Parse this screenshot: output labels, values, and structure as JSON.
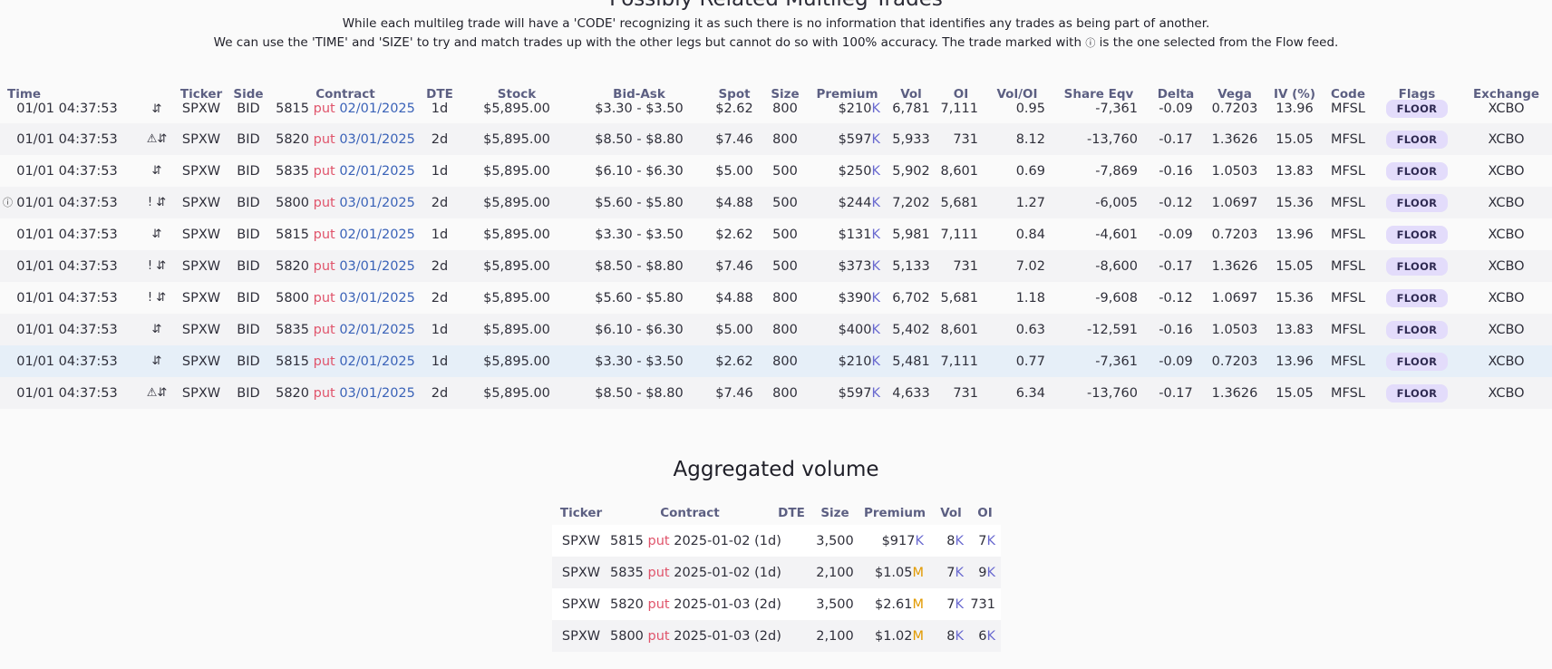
{
  "page": {
    "title": "Possibly Related Multileg Trades",
    "desc1": "While each multileg trade will have a 'CODE' recognizing it as such there is no information that identifies any trades as being part of another.",
    "desc2a": "We can use the 'TIME' and 'SIZE' to try and match trades up with the other legs but cannot do so with 100% accuracy. The trade marked with",
    "desc2b": "is the one selected from the Flow feed.",
    "info_icon": "ⓘ"
  },
  "columns": [
    "Time",
    "Ticker",
    "Side",
    "Contract",
    "DTE",
    "Stock",
    "Bid-Ask",
    "Spot",
    "Size",
    "Premium",
    "Vol",
    "OI",
    "Vol/OI",
    "Share Eqv",
    "Delta",
    "Vega",
    "IV (%)",
    "Code",
    "Flags",
    "Exchange"
  ],
  "rows": [
    {
      "time": "01/01 04:37:53",
      "icons": "⇵",
      "ticker": "SPXW",
      "side": "BID",
      "strike": "5815",
      "type": "put",
      "exp": "02/01/2025",
      "dte": "1d",
      "stock": "$5,895.00",
      "bidask": "$3.30 - $3.50",
      "spot": "$2.62",
      "size": "800",
      "size_hi": false,
      "prem": "$210",
      "prem_unit": "K",
      "vol": "6,781",
      "oi": "7,111",
      "voloi": "0.95",
      "share": "-7,361",
      "delta": "-0.09",
      "vega": "0.7203",
      "iv": "13.96",
      "code": "MFSL",
      "flag": "FLOOR",
      "exch": "XCBO",
      "selected": false,
      "info": false
    },
    {
      "time": "01/01 04:37:53",
      "icons": "⚠⇵",
      "ticker": "SPXW",
      "side": "BID",
      "strike": "5820",
      "type": "put",
      "exp": "03/01/2025",
      "dte": "2d",
      "stock": "$5,895.00",
      "bidask": "$8.50 - $8.80",
      "spot": "$7.46",
      "size": "800",
      "size_hi": true,
      "prem": "$597",
      "prem_unit": "K",
      "vol": "5,933",
      "oi": "731",
      "voloi": "8.12",
      "share": "-13,760",
      "delta": "-0.17",
      "vega": "1.3626",
      "iv": "15.05",
      "code": "MFSL",
      "flag": "FLOOR",
      "exch": "XCBO",
      "selected": false,
      "info": false
    },
    {
      "time": "01/01 04:37:53",
      "icons": "⇵",
      "ticker": "SPXW",
      "side": "BID",
      "strike": "5835",
      "type": "put",
      "exp": "02/01/2025",
      "dte": "1d",
      "stock": "$5,895.00",
      "bidask": "$6.10 - $6.30",
      "spot": "$5.00",
      "size": "500",
      "size_hi": false,
      "prem": "$250",
      "prem_unit": "K",
      "vol": "5,902",
      "oi": "8,601",
      "voloi": "0.69",
      "share": "-7,869",
      "delta": "-0.16",
      "vega": "1.0503",
      "iv": "13.83",
      "code": "MFSL",
      "flag": "FLOOR",
      "exch": "XCBO",
      "selected": false,
      "info": false
    },
    {
      "time": "01/01 04:37:53",
      "icons": "! ⇵",
      "ticker": "SPXW",
      "side": "BID",
      "strike": "5800",
      "type": "put",
      "exp": "03/01/2025",
      "dte": "2d",
      "stock": "$5,895.00",
      "bidask": "$5.60 - $5.80",
      "spot": "$4.88",
      "size": "500",
      "size_hi": false,
      "prem": "$244",
      "prem_unit": "K",
      "vol": "7,202",
      "oi": "5,681",
      "voloi": "1.27",
      "share": "-6,005",
      "delta": "-0.12",
      "vega": "1.0697",
      "iv": "15.36",
      "code": "MFSL",
      "flag": "FLOOR",
      "exch": "XCBO",
      "selected": false,
      "info": true
    },
    {
      "time": "01/01 04:37:53",
      "icons": "⇵",
      "ticker": "SPXW",
      "side": "BID",
      "strike": "5815",
      "type": "put",
      "exp": "02/01/2025",
      "dte": "1d",
      "stock": "$5,895.00",
      "bidask": "$3.30 - $3.50",
      "spot": "$2.62",
      "size": "500",
      "size_hi": false,
      "prem": "$131",
      "prem_unit": "K",
      "vol": "5,981",
      "oi": "7,111",
      "voloi": "0.84",
      "share": "-4,601",
      "delta": "-0.09",
      "vega": "0.7203",
      "iv": "13.96",
      "code": "MFSL",
      "flag": "FLOOR",
      "exch": "XCBO",
      "selected": false,
      "info": false
    },
    {
      "time": "01/01 04:37:53",
      "icons": "! ⇵",
      "ticker": "SPXW",
      "side": "BID",
      "strike": "5820",
      "type": "put",
      "exp": "03/01/2025",
      "dte": "2d",
      "stock": "$5,895.00",
      "bidask": "$8.50 - $8.80",
      "spot": "$7.46",
      "size": "500",
      "size_hi": false,
      "prem": "$373",
      "prem_unit": "K",
      "vol": "5,133",
      "oi": "731",
      "voloi": "7.02",
      "share": "-8,600",
      "delta": "-0.17",
      "vega": "1.3626",
      "iv": "15.05",
      "code": "MFSL",
      "flag": "FLOOR",
      "exch": "XCBO",
      "selected": false,
      "info": false
    },
    {
      "time": "01/01 04:37:53",
      "icons": "! ⇵",
      "ticker": "SPXW",
      "side": "BID",
      "strike": "5800",
      "type": "put",
      "exp": "03/01/2025",
      "dte": "2d",
      "stock": "$5,895.00",
      "bidask": "$5.60 - $5.80",
      "spot": "$4.88",
      "size": "800",
      "size_hi": false,
      "prem": "$390",
      "prem_unit": "K",
      "vol": "6,702",
      "oi": "5,681",
      "voloi": "1.18",
      "share": "-9,608",
      "delta": "-0.12",
      "vega": "1.0697",
      "iv": "15.36",
      "code": "MFSL",
      "flag": "FLOOR",
      "exch": "XCBO",
      "selected": false,
      "info": false
    },
    {
      "time": "01/01 04:37:53",
      "icons": "⇵",
      "ticker": "SPXW",
      "side": "BID",
      "strike": "5835",
      "type": "put",
      "exp": "02/01/2025",
      "dte": "1d",
      "stock": "$5,895.00",
      "bidask": "$6.10 - $6.30",
      "spot": "$5.00",
      "size": "800",
      "size_hi": false,
      "prem": "$400",
      "prem_unit": "K",
      "vol": "5,402",
      "oi": "8,601",
      "voloi": "0.63",
      "share": "-12,591",
      "delta": "-0.16",
      "vega": "1.0503",
      "iv": "13.83",
      "code": "MFSL",
      "flag": "FLOOR",
      "exch": "XCBO",
      "selected": false,
      "info": false
    },
    {
      "time": "01/01 04:37:53",
      "icons": "⇵",
      "ticker": "SPXW",
      "side": "BID",
      "strike": "5815",
      "type": "put",
      "exp": "02/01/2025",
      "dte": "1d",
      "stock": "$5,895.00",
      "bidask": "$3.30 - $3.50",
      "spot": "$2.62",
      "size": "800",
      "size_hi": false,
      "prem": "$210",
      "prem_unit": "K",
      "vol": "5,481",
      "oi": "7,111",
      "voloi": "0.77",
      "share": "-7,361",
      "delta": "-0.09",
      "vega": "0.7203",
      "iv": "13.96",
      "code": "MFSL",
      "flag": "FLOOR",
      "exch": "XCBO",
      "selected": true,
      "info": false
    },
    {
      "time": "01/01 04:37:53",
      "icons": "⚠⇵",
      "ticker": "SPXW",
      "side": "BID",
      "strike": "5820",
      "type": "put",
      "exp": "03/01/2025",
      "dte": "2d",
      "stock": "$5,895.00",
      "bidask": "$8.50 - $8.80",
      "spot": "$7.46",
      "size": "800",
      "size_hi": true,
      "prem": "$597",
      "prem_unit": "K",
      "vol": "4,633",
      "oi": "731",
      "voloi": "6.34",
      "share": "-13,760",
      "delta": "-0.17",
      "vega": "1.3626",
      "iv": "15.05",
      "code": "MFSL",
      "flag": "FLOOR",
      "exch": "XCBO",
      "selected": false,
      "info": false
    }
  ],
  "aggregated": {
    "title": "Aggregated volume",
    "columns": [
      "Ticker",
      "Contract",
      "DTE",
      "Size",
      "Premium",
      "Vol",
      "OI"
    ],
    "rows": [
      {
        "ticker": "SPXW",
        "strike": "5815",
        "type": "put",
        "exp": "2025-01-02",
        "dte": "(1d)",
        "size": "3,500",
        "prem": "$917",
        "prem_unit": "K",
        "vol": "8",
        "vol_unit": "K",
        "oi": "7",
        "oi_unit": "K"
      },
      {
        "ticker": "SPXW",
        "strike": "5835",
        "type": "put",
        "exp": "2025-01-02",
        "dte": "(1d)",
        "size": "2,100",
        "prem": "$1.05",
        "prem_unit": "M",
        "vol": "7",
        "vol_unit": "K",
        "oi": "9",
        "oi_unit": "K"
      },
      {
        "ticker": "SPXW",
        "strike": "5820",
        "type": "put",
        "exp": "2025-01-03",
        "dte": "(2d)",
        "size": "3,500",
        "prem": "$2.61",
        "prem_unit": "M",
        "vol": "7",
        "vol_unit": "K",
        "oi": "731",
        "oi_unit": ""
      },
      {
        "ticker": "SPXW",
        "strike": "5800",
        "type": "put",
        "exp": "2025-01-03",
        "dte": "(2d)",
        "size": "2,100",
        "prem": "$1.02",
        "prem_unit": "M",
        "vol": "8",
        "vol_unit": "K",
        "oi": "6",
        "oi_unit": "K"
      }
    ]
  },
  "colors": {
    "side": "#e4ad12",
    "put": "#e0546b",
    "expiry": "#3b63b8",
    "k_unit": "#6a6ad0",
    "m_unit": "#e29a00",
    "flag_bg": "#e3dcfb",
    "selected_row": "#e6eff8"
  }
}
